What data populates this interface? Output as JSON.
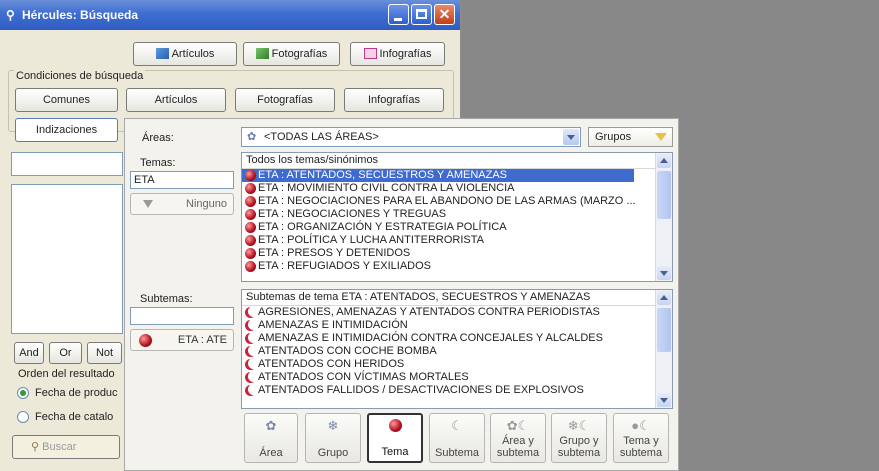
{
  "window": {
    "title": "Hércules: Búsqueda"
  },
  "toolbar": {
    "articulos": "Artículos",
    "fotografias": "Fotografías",
    "infografias": "Infografías"
  },
  "conditions": {
    "label": "Condiciones de búsqueda",
    "tabs": [
      "Comunes",
      "Artículos",
      "Fotografías",
      "Infografías"
    ],
    "indizaciones": "Indizaciones"
  },
  "logic": {
    "and": "And",
    "or": "Or",
    "not": "Not"
  },
  "order": {
    "label": "Orden del resultado",
    "options": [
      "Fecha de produc",
      "Fecha de catalo"
    ]
  },
  "search_button": "Buscar",
  "panel": {
    "areas_label": "Áreas:",
    "areas_value": "<TODAS LAS ÁREAS>",
    "grupos": "Grupos",
    "temas_label": "Temas:",
    "temas_value": "ETA",
    "ninguno": "Ninguno",
    "temas_list": {
      "header": "Todos los temas/sinónimos",
      "items": [
        "ETA : ATENTADOS, SECUESTROS Y AMENAZAS",
        "ETA : MOVIMIENTO CIVIL CONTRA LA VIOLENCIA",
        "ETA : NEGOCIACIONES PARA EL ABANDONO DE LAS ARMAS (MARZO ...",
        "ETA : NEGOCIACIONES Y TREGUAS",
        "ETA : ORGANIZACIÓN Y ESTRATEGIA POLÍTICA",
        "ETA : POLÍTICA Y LUCHA ANTITERRORISTA",
        "ETA : PRESOS Y DETENIDOS",
        "ETA : REFUGIADOS Y EXILIADOS"
      ]
    },
    "subtemas_label": "Subtemas:",
    "selected_tema": "ETA : ATE",
    "subtemas_list": {
      "header": "Subtemas de tema ETA : ATENTADOS, SECUESTROS Y AMENAZAS",
      "items": [
        "AGRESIONES, AMENAZAS Y ATENTADOS CONTRA PERIODISTAS",
        "AMENAZAS E INTIMIDACIÓN",
        "AMENAZAS E INTIMIDACIÓN CONTRA CONCEJALES Y ALCALDES",
        "ATENTADOS CON COCHE BOMBA",
        "ATENTADOS CON HERIDOS",
        "ATENTADOS CON VÍCTIMAS MORTALES",
        "ATENTADOS FALLIDOS / DESACTIVACIONES DE EXPLOSIVOS"
      ]
    },
    "mode_buttons": [
      {
        "l1": "",
        "l2": "Área",
        "icon": "area-icon"
      },
      {
        "l1": "",
        "l2": "Grupo",
        "icon": "group-icon"
      },
      {
        "l1": "",
        "l2": "Tema",
        "icon": "topic-icon"
      },
      {
        "l1": "",
        "l2": "Subtema",
        "icon": "subtopic-icon"
      },
      {
        "l1": "Área y",
        "l2": "subtema",
        "icon": "area-subtopic-icon"
      },
      {
        "l1": "Grupo y",
        "l2": "subtema",
        "icon": "group-subtopic-icon"
      },
      {
        "l1": "Tema y",
        "l2": "subtema",
        "icon": "topic-subtopic-icon"
      }
    ]
  },
  "colors": {
    "title_bar": "#3f6ed1",
    "selection": "#3f6bd0",
    "accent_red": "#b10f1f"
  }
}
